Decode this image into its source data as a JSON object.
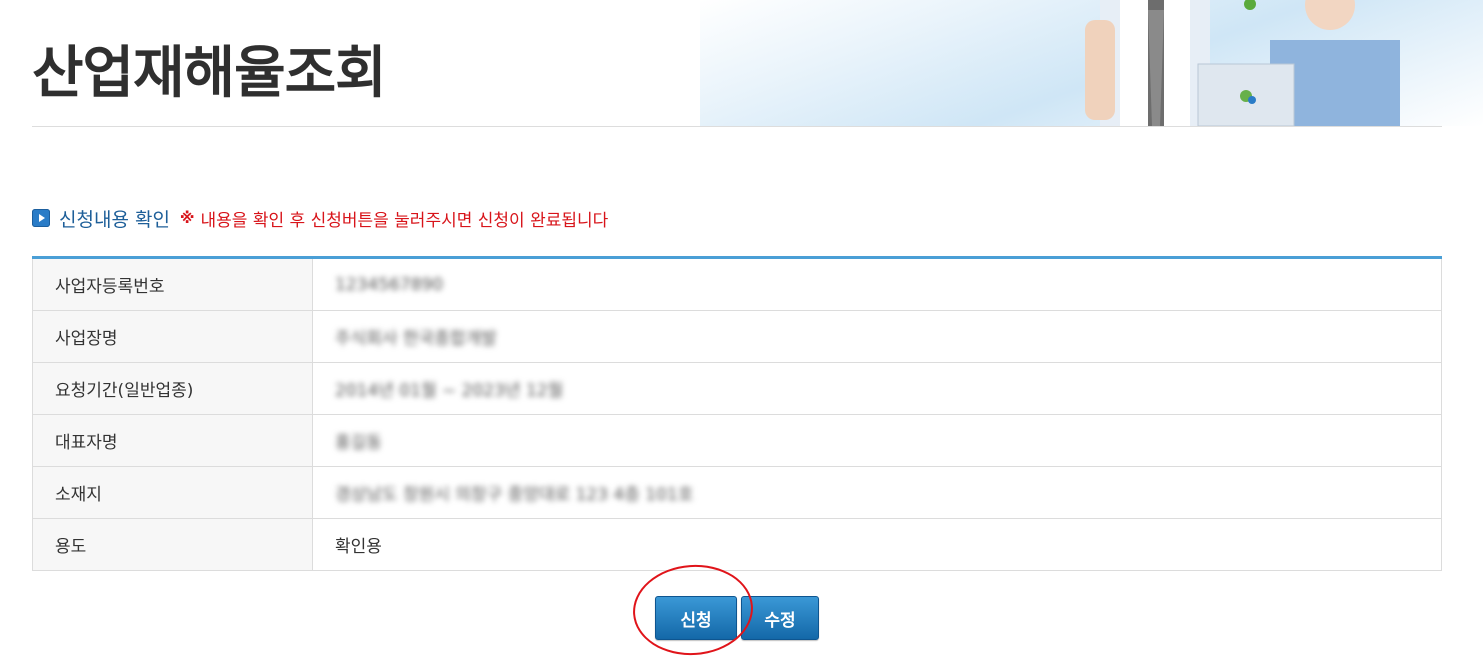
{
  "header": {
    "title": "산업재해율조회"
  },
  "section": {
    "icon": "play-bullet-icon",
    "title": "신청내용 확인",
    "note_mark": "※",
    "note": "내용을 확인 후 신청버튼을 눌러주시면 신청이 완료됩니다"
  },
  "table": {
    "rows": [
      {
        "label": "사업자등록번호",
        "value": "1234567890"
      },
      {
        "label": "사업장명",
        "value": "주식회사 한국종합개발"
      },
      {
        "label": "요청기간(일반업종)",
        "value": "2014년 01월 ~ 2023년 12월"
      },
      {
        "label": "대표자명",
        "value": "홍길동"
      },
      {
        "label": "소재지",
        "value": "경상남도 창원시 의창구 중앙대로 123 4층 101호"
      },
      {
        "label": "용도",
        "value": "확인용"
      }
    ]
  },
  "buttons": {
    "apply_label": "신청",
    "edit_label": "수정"
  },
  "colors": {
    "accent": "#2a7cc7",
    "table_top_border": "#4a9fd6",
    "note_red": "#d8141a",
    "highlight_ring": "#e0141a"
  }
}
